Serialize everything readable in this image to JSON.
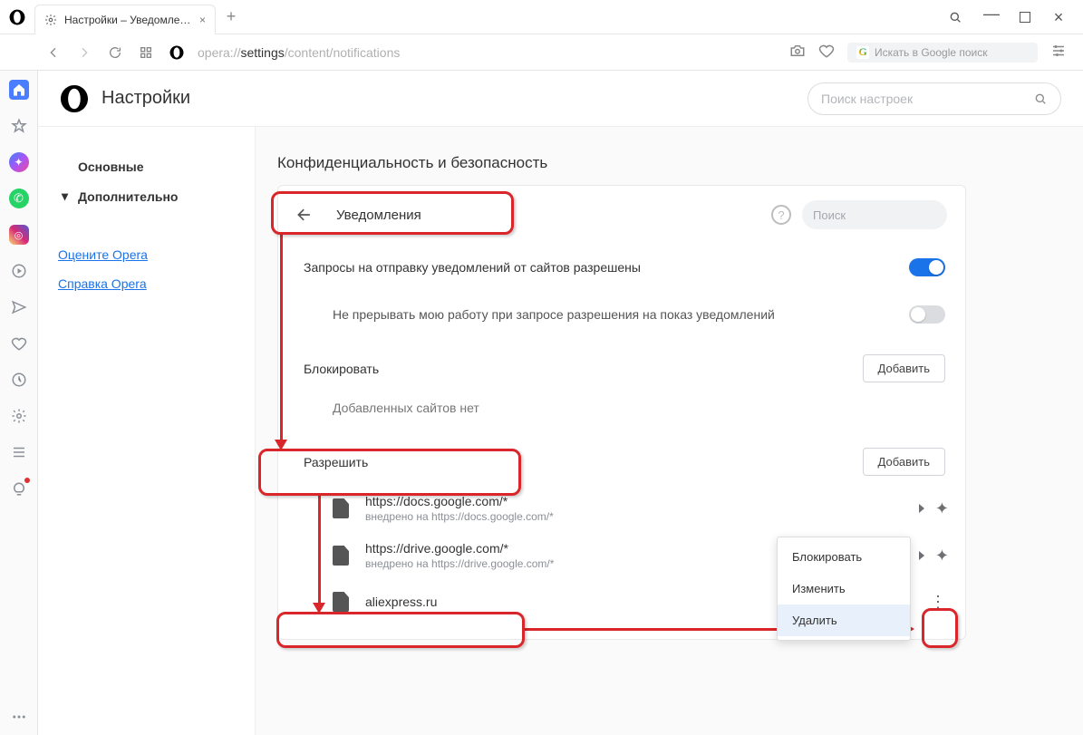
{
  "tab": {
    "title": "Настройки – Уведомления"
  },
  "url": {
    "prefix": "opera://",
    "dark": "settings",
    "suffix": "/content/notifications"
  },
  "google_search_placeholder": "Искать в Google поиск",
  "header": {
    "title": "Настройки",
    "search_placeholder": "Поиск настроек"
  },
  "sidebar": {
    "main": "Основные",
    "advanced": "Дополнительно",
    "rate": "Оцените Opera",
    "help": "Справка Opera"
  },
  "section_title": "Конфиденциальность и безопасность",
  "card": {
    "title": "Уведомления",
    "search_placeholder": "Поиск",
    "allow_requests": "Запросы на отправку уведомлений от сайтов разрешены",
    "quiet": "Не прерывать мою работу при запросе разрешения на показ уведомлений",
    "block_title": "Блокировать",
    "block_empty": "Добавленных сайтов нет",
    "allow_title": "Разрешить",
    "add_button": "Добавить",
    "sites": [
      {
        "url": "https://docs.google.com/*",
        "sub": "внедрено на https://docs.google.com/*"
      },
      {
        "url": "https://drive.google.com/*",
        "sub": "внедрено на https://drive.google.com/*"
      },
      {
        "url": "aliexpress.ru",
        "sub": ""
      }
    ]
  },
  "popup": {
    "block": "Блокировать",
    "edit": "Изменить",
    "delete": "Удалить"
  }
}
